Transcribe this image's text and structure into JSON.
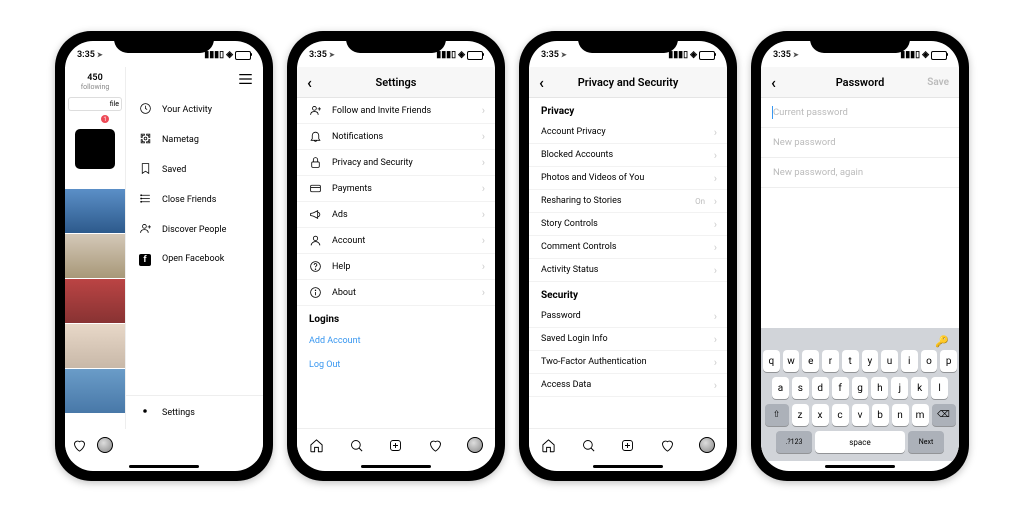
{
  "status": {
    "time": "3:35",
    "loc_icon": "➤"
  },
  "phone1": {
    "stats_count": "450",
    "stats_label": "following",
    "edit_btn": "file",
    "tag_badge": "1",
    "menu": {
      "activity": "Your Activity",
      "nametag": "Nametag",
      "saved": "Saved",
      "close_friends": "Close Friends",
      "discover": "Discover People",
      "open_fb": "Open Facebook"
    },
    "settings": "Settings"
  },
  "phone2": {
    "title": "Settings",
    "rows": {
      "follow_invite": "Follow and Invite Friends",
      "notifications": "Notifications",
      "privacy": "Privacy and Security",
      "payments": "Payments",
      "ads": "Ads",
      "account": "Account",
      "help": "Help",
      "about": "About"
    },
    "logins_header": "Logins",
    "add_account": "Add Account",
    "log_out": "Log Out"
  },
  "phone3": {
    "title": "Privacy and Security",
    "privacy_header": "Privacy",
    "rows": {
      "account_privacy": "Account Privacy",
      "blocked": "Blocked Accounts",
      "photos": "Photos and Videos of You",
      "resharing": "Resharing to Stories",
      "resharing_val": "On",
      "story_controls": "Story Controls",
      "comment_controls": "Comment Controls",
      "activity_status": "Activity Status"
    },
    "security_header": "Security",
    "rows2": {
      "password": "Password",
      "saved_login": "Saved Login Info",
      "twofa": "Two-Factor Authentication",
      "access_data": "Access Data"
    }
  },
  "phone4": {
    "title": "Password",
    "save": "Save",
    "fields": {
      "current": "Current password",
      "new": "New password",
      "again": "New password, again"
    },
    "keyboard": {
      "row1": [
        "q",
        "w",
        "e",
        "r",
        "t",
        "y",
        "u",
        "i",
        "o",
        "p"
      ],
      "row2": [
        "a",
        "s",
        "d",
        "f",
        "g",
        "h",
        "j",
        "k",
        "l"
      ],
      "row3": [
        "z",
        "x",
        "c",
        "v",
        "b",
        "n",
        "m"
      ],
      "shift": "⇧",
      "backspace": "⌫",
      "num": ".?123",
      "space": "space",
      "next": "Next"
    }
  }
}
